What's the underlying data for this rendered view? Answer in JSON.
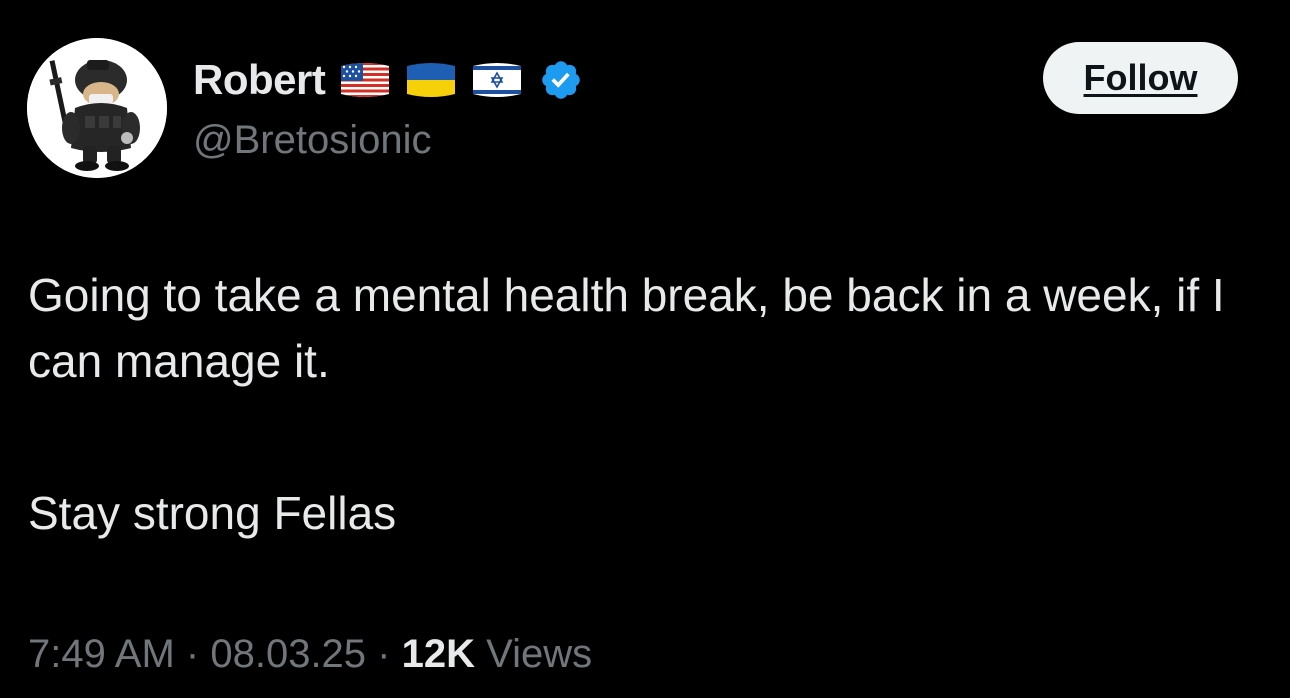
{
  "user": {
    "display_name": "Robert",
    "handle": "@Bretosionic",
    "flags": [
      "us-flag-icon",
      "ukraine-flag-icon",
      "israel-flag-icon"
    ],
    "verified": true,
    "verified_color": "#1d9bf0"
  },
  "follow_button": {
    "label": "Follow"
  },
  "tweet": {
    "paragraph_1": "Going to take a mental health break, be back in a week, if I can manage it.",
    "paragraph_2": "Stay strong Fellas"
  },
  "meta": {
    "time": "7:49 AM",
    "separator": "·",
    "date": "08.03.25",
    "views_count": "12K",
    "views_label": "Views"
  },
  "colors": {
    "background": "#000000",
    "primary_text": "#e7e9ea",
    "secondary_text": "#71767b",
    "button_bg": "#eff3f4"
  }
}
